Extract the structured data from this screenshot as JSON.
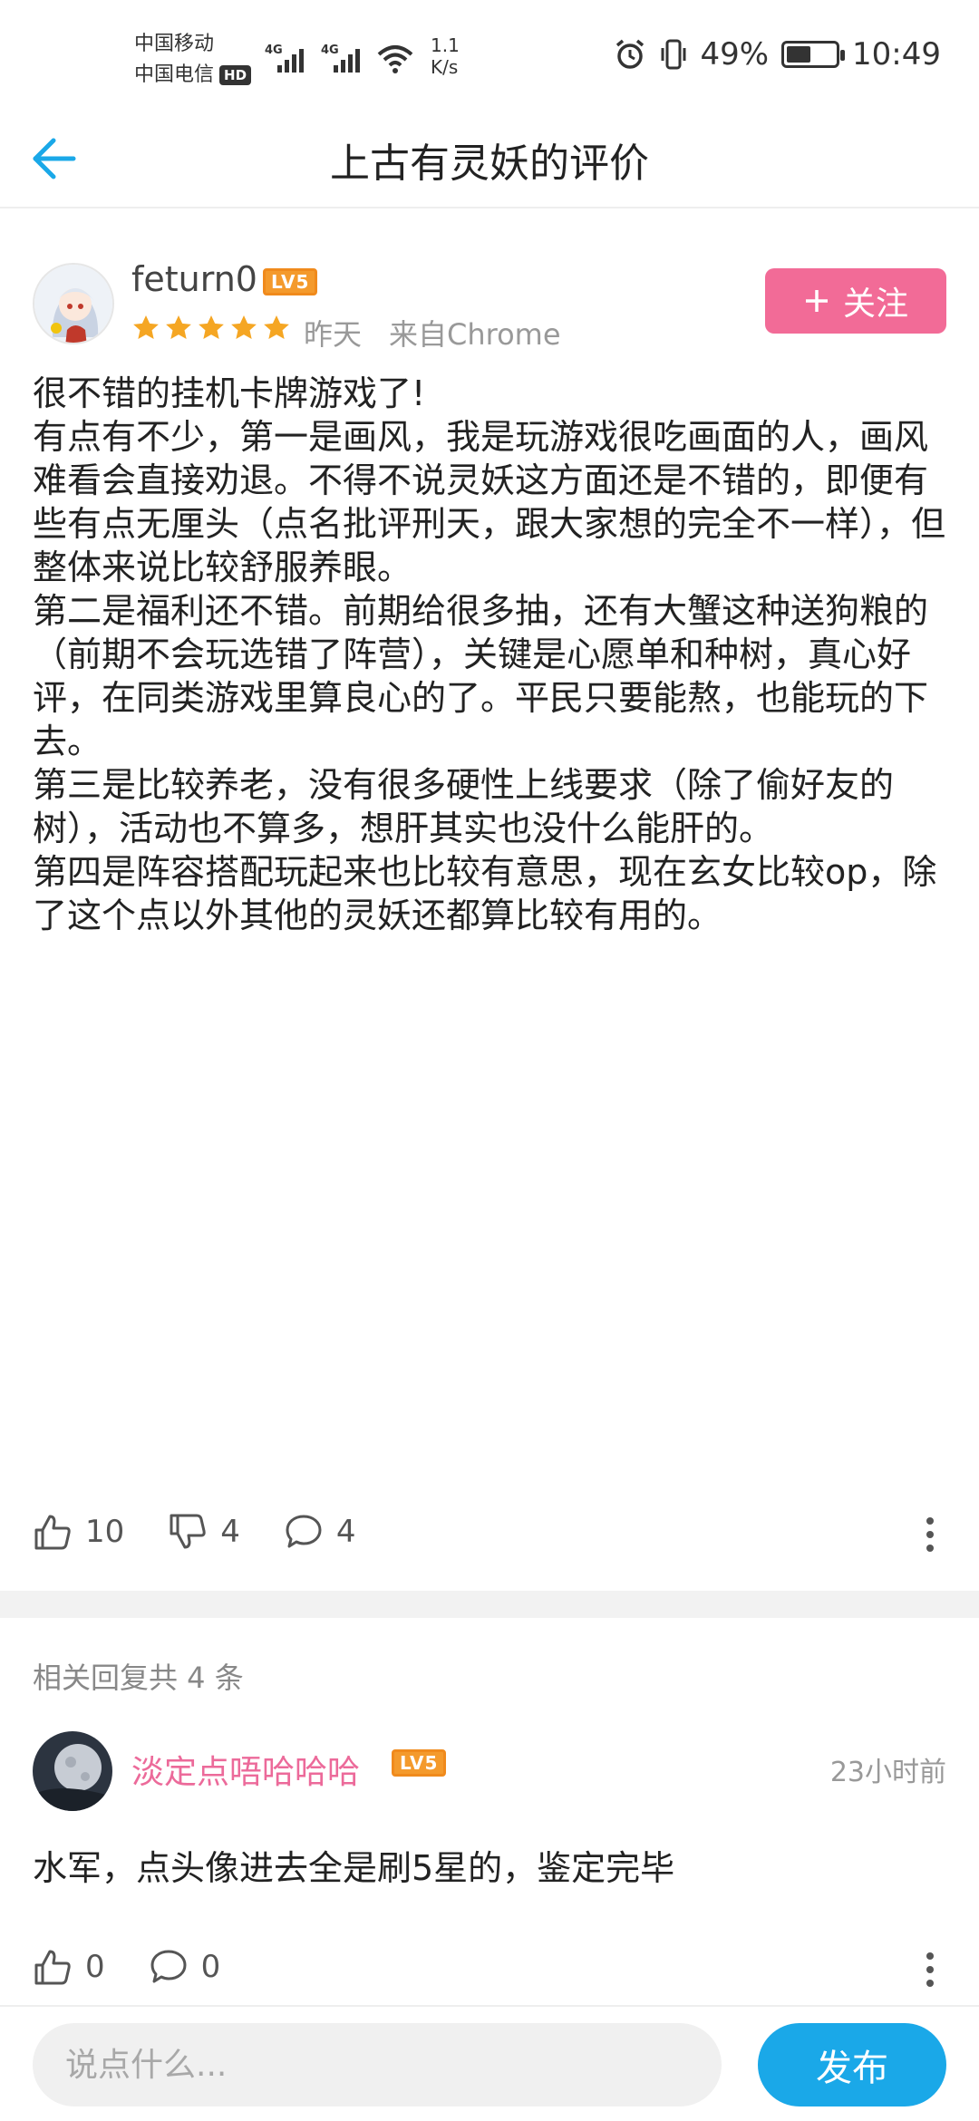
{
  "status_bar": {
    "carrier1": "中国移动",
    "carrier2": "中国电信",
    "hd": "HD",
    "net1": "4G",
    "net2": "4G",
    "speed_value": "1.1",
    "speed_unit": "K/s",
    "battery": "49%",
    "time": "10:49"
  },
  "header": {
    "title": "上古有灵妖的评价"
  },
  "review": {
    "username": "feturn0",
    "level": "LV5",
    "rating": 5,
    "date": "昨天",
    "source": "来自Chrome",
    "follow_label": "关注",
    "paragraphs": [
      "很不错的挂机卡牌游戏了!",
      "有点有不少，第一是画风，我是玩游戏很吃画面的人，画风难看会直接劝退。不得不说灵妖这方面还是不错的，即便有些有点无厘头（点名批评刑天，跟大家想的完全不一样），但整体来说比较舒服养眼。",
      "第二是福利还不错。前期给很多抽，还有大蟹这种送狗粮的（前期不会玩选错了阵营），关键是心愿单和种树，真心好评，在同类游戏里算良心的了。平民只要能熬，也能玩的下去。",
      "第三是比较养老，没有很多硬性上线要求（除了偷好友的树），活动也不算多，想肝其实也没什么能肝的。",
      "第四是阵容搭配玩起来也比较有意思，现在玄女比较op，除了这个点以外其他的灵妖还都算比较有用的。"
    ],
    "likes": "10",
    "dislikes": "4",
    "comments": "4"
  },
  "replies": {
    "count_label": "相关回复共 4 条",
    "items": [
      {
        "username": "淡定点唔哈哈哈",
        "level": "LV5",
        "time": "23小时前",
        "text": "水军，点头像进去全是刷5星的，鉴定完毕",
        "likes": "0",
        "comments": "0"
      }
    ]
  },
  "bottom": {
    "input_placeholder": "说点什么...",
    "publish_label": "发布"
  },
  "colors": {
    "accent_blue": "#1aa8e8",
    "follow_pink": "#f26b97",
    "star_orange": "#f5a623",
    "level_orange": "#f49a2c"
  }
}
